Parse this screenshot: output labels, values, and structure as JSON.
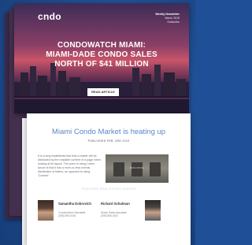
{
  "newsletter": {
    "brand": "cndo",
    "meta_lines": [
      "Weekly Newsletter",
      "March 2015",
      "Subscribe"
    ],
    "headline_lines": [
      "CONDOWATCH MIAMI:",
      "MIAMI-DADE CONDO SALES",
      "NORTH OF $41 MILLION"
    ],
    "read_button": "READ ARTICLE"
  },
  "article": {
    "title": "Miami Condo Market is heating up",
    "date": "PUBLISHED FEB. 3RD 2015",
    "body": "It is a long established fact that a reader will be distracted by the readable content of a page when looking at its layout. The point of using Lorem Ipsum is that it has a more-or-less normal distribution of letters, as opposed to using 'Content'.",
    "photo_caption": "BUILDING",
    "subhead": "FEATURED REAL ESTATE AGENTS"
  },
  "agents": [
    {
      "name": "Samantha Dobrovich",
      "details": [
        "Condominium Specialist",
        "(305) 555-0148"
      ]
    },
    {
      "name": "Richard Schulman",
      "details": [
        "Senior Sales Associate",
        "(305) 555-0192"
      ]
    }
  ],
  "colors": {
    "background": "#1f4f96",
    "accent_title": "#5a86c4",
    "brand_dot": "#e84f6b"
  }
}
